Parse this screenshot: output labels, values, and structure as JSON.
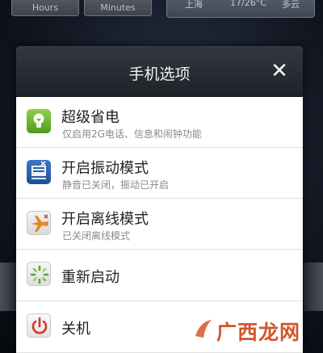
{
  "background": {
    "hours_label": "Hours",
    "minutes_label": "Minutes",
    "weather_city": "上海",
    "weather_temp": "17/26°C",
    "weather_condition": "多云"
  },
  "dialog": {
    "title": "手机选项",
    "close_glyph": "✕",
    "options": [
      {
        "title": "超级省电",
        "subtitle": "仅启用2G电话、信息和闹钟功能",
        "icon": "lightbulb-icon"
      },
      {
        "title": "开启振动模式",
        "subtitle": "静音已关闭，振动已开启",
        "icon": "vibrate-icon"
      },
      {
        "title": "开启离线模式",
        "subtitle": "已关闭离线模式",
        "icon": "airplane-icon"
      },
      {
        "title": "重新启动",
        "icon": "restart-icon"
      },
      {
        "title": "关机",
        "icon": "power-icon"
      }
    ]
  },
  "watermark": {
    "text": "广西龙网"
  },
  "colors": {
    "header_dark": "#25282e",
    "power_saver_green": "#5aa82a",
    "vibrate_blue": "#2a61a8",
    "airplane_orange": "#e08a1e",
    "power_red": "#d0392b",
    "watermark_red": "#d4552c"
  }
}
